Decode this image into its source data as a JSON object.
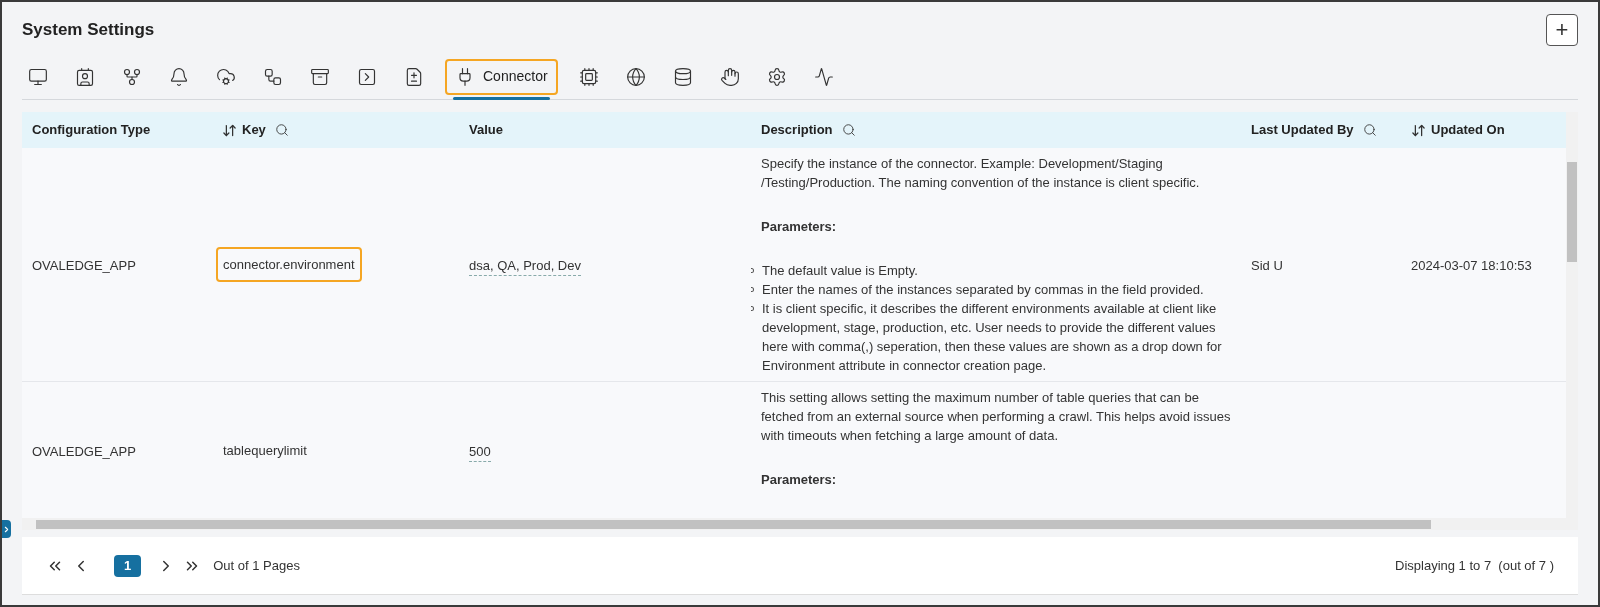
{
  "title": "System Settings",
  "add_button": "+",
  "tabs": [
    {
      "kind": "monitor",
      "selected": false
    },
    {
      "kind": "badge",
      "selected": false
    },
    {
      "kind": "nodes",
      "selected": false
    },
    {
      "kind": "bell",
      "selected": false
    },
    {
      "kind": "cloud",
      "selected": false
    },
    {
      "kind": "workflow",
      "selected": false
    },
    {
      "kind": "archive",
      "selected": false
    },
    {
      "kind": "play",
      "selected": false
    },
    {
      "kind": "file",
      "selected": false
    },
    {
      "kind": "plug",
      "label": "Connector",
      "selected": true
    },
    {
      "kind": "chip",
      "selected": false
    },
    {
      "kind": "globe",
      "selected": false
    },
    {
      "kind": "database",
      "selected": false
    },
    {
      "kind": "hand",
      "selected": false
    },
    {
      "kind": "gear",
      "selected": false
    },
    {
      "kind": "pulse",
      "selected": false
    }
  ],
  "table": {
    "columns": [
      {
        "label": "Configuration Type",
        "kind": "plain"
      },
      {
        "label": "Key",
        "kind": "sortsearch"
      },
      {
        "label": "Value",
        "kind": "plain"
      },
      {
        "label": "Description",
        "kind": "search"
      },
      {
        "label": "Last Updated By",
        "kind": "search"
      },
      {
        "label": "Updated On",
        "kind": "sort"
      }
    ],
    "rows": [
      {
        "configuration_type": "OVALEDGE_APP",
        "key": "connector.environment",
        "key_highlighted": true,
        "value": "dsa, QA, Prod, Dev",
        "description": {
          "text": "Specify the instance of the connector. Example: Development/Staging /Testing/Production. The naming convention of the instance is client specific.",
          "heading": "Parameters:",
          "bullets": [
            "The default value is Empty.",
            "Enter the names of the instances separated by commas in the field provided.",
            "It is client specific, it describes the different environments available at client like development, stage, production, etc. User needs to provide the different values here with comma(,) seperation, then these values are shown as a drop down for Environment attribute in connector creation page."
          ]
        },
        "last_updated_by": "Sid U",
        "updated_on": "2024-03-07 18:10:53"
      },
      {
        "configuration_type": "OVALEDGE_APP",
        "key": "tablequerylimit",
        "key_highlighted": false,
        "value": "500",
        "description": {
          "text": "This setting allows setting the maximum number of table queries that can be fetched from an external source when performing a crawl. This helps avoid issues with timeouts when fetching a large amount of data.",
          "heading": "Parameters:"
        }
      }
    ]
  },
  "pagination": {
    "current_page": "1",
    "pages_text": "Out of 1 Pages",
    "summary": "Displaying 1 to 7  (out of 7 )"
  }
}
